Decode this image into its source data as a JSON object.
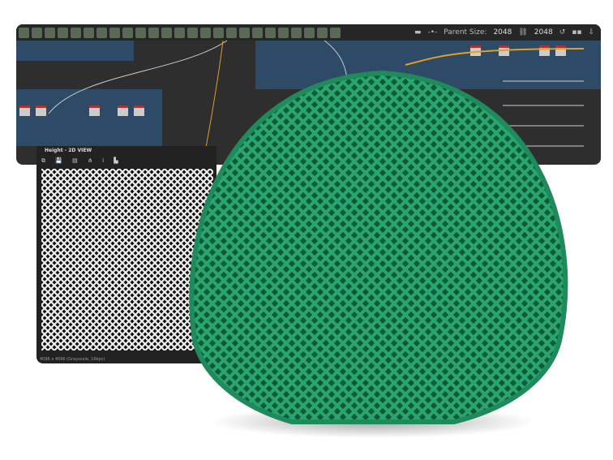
{
  "toolbar": {
    "parent_size_label": "Parent Size:",
    "parent_size_value": "2048",
    "size_value": "2048"
  },
  "view2d": {
    "title": "Height - 2D VIEW",
    "tool_icons": "⧉ 💾 ▤ ⋔ i ▙",
    "info": "4096 x 4096 (Grayscale, 16bpc)"
  },
  "colors": {
    "fabric": "#1f8a5b",
    "graph_bg": "#2e2e2e",
    "frame_blue": "#2d4a66"
  }
}
